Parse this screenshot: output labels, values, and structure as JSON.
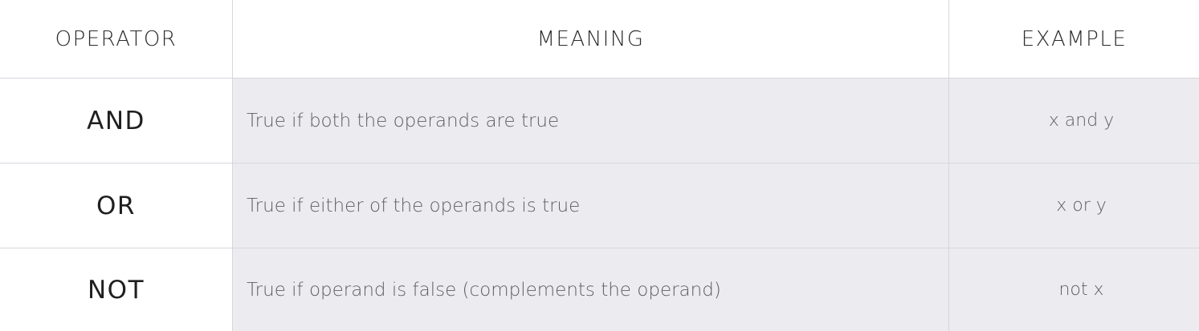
{
  "headers": {
    "operator": "OPERATOR",
    "meaning": "MEANING",
    "example": "EXAMPLE"
  },
  "rows": [
    {
      "operator": "AND",
      "meaning": "True if both the operands are true",
      "example": "x and y"
    },
    {
      "operator": "OR",
      "meaning": "True if either of the operands is true",
      "example": "x or y"
    },
    {
      "operator": "NOT",
      "meaning": "True if operand is false (complements the operand)",
      "example": "not x"
    }
  ]
}
